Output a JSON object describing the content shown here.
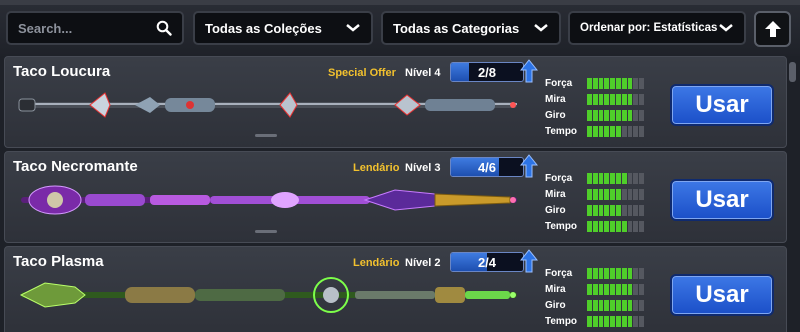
{
  "toolbar": {
    "search_placeholder": "Search...",
    "collections": "Todas as Coleções",
    "categories": "Todas as Categorias",
    "sort": "Ordenar por: Estatísticas"
  },
  "stat_labels": [
    "Força",
    "Mira",
    "Giro",
    "Tempo"
  ],
  "cues": [
    {
      "name": "Taco Loucura",
      "tag": "Special Offer",
      "level": "Nível 4",
      "progress": "2/8",
      "progress_fraction": 0.25,
      "stats": [
        8,
        8,
        8,
        6
      ],
      "button": "Usar"
    },
    {
      "name": "Taco Necromante",
      "tag": "Lendário",
      "level": "Nível 3",
      "progress": "4/6",
      "progress_fraction": 0.67,
      "stats": [
        7,
        6,
        6,
        7
      ],
      "button": "Usar"
    },
    {
      "name": "Taco Plasma",
      "tag": "Lendário",
      "level": "Nível 2",
      "progress": "2/4",
      "progress_fraction": 0.5,
      "stats": [
        8,
        8,
        8,
        8
      ],
      "button": "Usar"
    }
  ],
  "colors": {
    "tag": "#f2c12e",
    "stat_on": "#4fce2a",
    "button": "#2a62d8"
  }
}
